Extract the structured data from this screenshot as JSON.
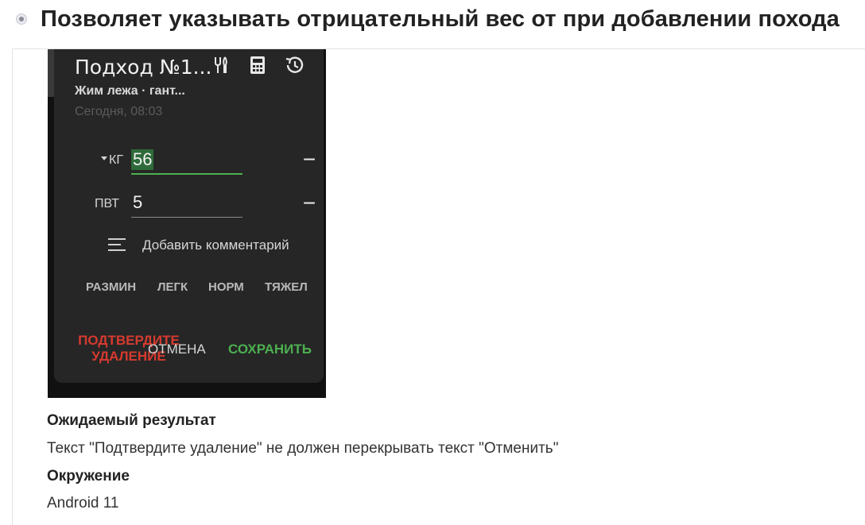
{
  "issue": {
    "title": "Позволяет указывать отрицательный вес от при добавлении похода"
  },
  "dialog": {
    "title": "Подход №1...",
    "subtitle": "Жим лежа · гант...",
    "date": "Сегодня, 08:03",
    "icons": [
      "tools-icon",
      "calculator-icon",
      "history-icon"
    ],
    "weight": {
      "label": "КГ",
      "value": "56"
    },
    "reps": {
      "label": "ПВТ",
      "value": "5"
    },
    "steppers": {
      "minus": "−",
      "plus": "+"
    },
    "comment_label": "Добавить комментарий",
    "tags": [
      "РАЗМИН",
      "ЛЕГК",
      "НОРМ",
      "ТЯЖЕЛ"
    ],
    "actions": {
      "delete_line1": "ПОДТВЕРДИТЕ",
      "delete_line2": "УДАЛЕНИЕ",
      "cancel": "ОТМЕНА",
      "save": "СОХРАНИТЬ"
    },
    "colors": {
      "background": "#262626",
      "accent": "#4caf50",
      "danger": "#d63a2f"
    }
  },
  "expected": {
    "label": "Ожидаемый результат",
    "text": "Текст \"Подтвердите удаление\" не должен перекрывать текст \"Отменить\""
  },
  "environment": {
    "label": "Окружение",
    "text": "Android 11"
  }
}
